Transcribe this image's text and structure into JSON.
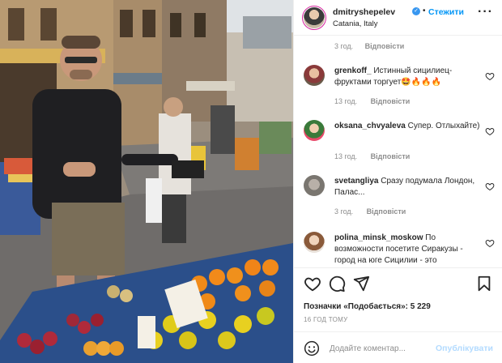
{
  "post": {
    "author": "dmitryshepelev",
    "verified": true,
    "follow_label": "Стежити",
    "location": "Catania, Italy",
    "caption_time": "3 год.",
    "caption_reply": "Відповісти",
    "more_icon": "more-horizontal-icon"
  },
  "comments": [
    {
      "user": "grenkoff_",
      "text": "Истинный сицилиец-фруктами торгует🤩🔥🔥🔥",
      "time": "13 год.",
      "reply": "Відповісти"
    },
    {
      "user": "oksana_chvyaleva",
      "text": "Супер. Отлыхайте)",
      "time": "13 год.",
      "reply": "Відповісти"
    },
    {
      "user": "svetangliya",
      "text": "Сразу подумала Лондон, Палас...",
      "time": "3 год.",
      "reply": "Відповісти"
    },
    {
      "user": "polina_minsk_moskow",
      "text": "По возможности посетите Сиракузы - город на юге Сицилии - это",
      "time": "",
      "reply": ""
    }
  ],
  "actions": {
    "likes_prefix": "Позначки «Подобається»:",
    "likes_count": "5 229",
    "posted": "16 ГОД ТОМУ",
    "comment_placeholder": "Додайте коментар...",
    "publish_label": "Опублікувати",
    "icons": [
      "heart-icon",
      "comment-icon",
      "share-icon",
      "bookmark-icon",
      "emoji-icon"
    ]
  },
  "colors": {
    "follow": "#0095f6",
    "verified": "#3897f0",
    "publish_disabled": "#b3dbff",
    "muted": "#8e8e8e"
  }
}
